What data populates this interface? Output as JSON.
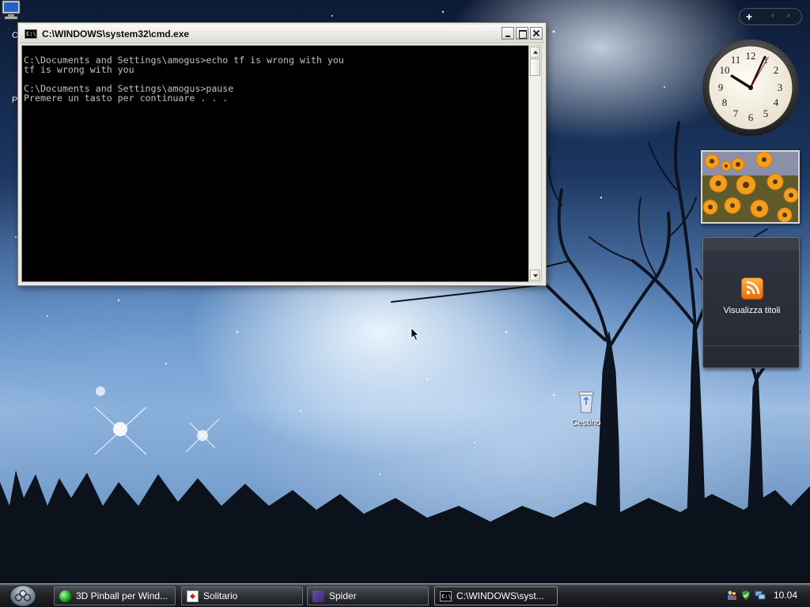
{
  "desktop": {
    "icons": [
      {
        "label": "Cestino"
      }
    ]
  },
  "cmd_window": {
    "title": "C:\\WINDOWS\\system32\\cmd.exe",
    "app_icon_text": "C:\\",
    "output": "C:\\Documents and Settings\\amogus>echo tf is wrong with you\ntf is wrong with you\n\nC:\\Documents and Settings\\amogus>pause\nPremere un tasto per continuare . . ."
  },
  "sidebar": {
    "add_label": "+",
    "prev_label": "‹",
    "next_label": "›",
    "clock": {
      "hour": 10,
      "minute": 4,
      "second": 5
    },
    "feed_gadget": {
      "label": "Visualizza titoli",
      "icon": "rss-icon"
    }
  },
  "taskbar": {
    "buttons": [
      {
        "label": "3D Pinball per Wind...",
        "icon": "pinball-icon"
      },
      {
        "label": "Solitario",
        "icon": "solitaire-icon"
      },
      {
        "label": "Spider",
        "icon": "spider-solitaire-icon"
      },
      {
        "label": "C:\\WINDOWS\\syst...",
        "icon": "cmd-icon",
        "active": true
      }
    ],
    "cmd_icon_text": "C:\\",
    "tray_clock": "10.04"
  },
  "colors": {
    "console_bg": "#000000",
    "console_text": "#c0c0c0",
    "taskbar_bg": "#1e2024",
    "rss_orange": "#f08a1c"
  }
}
